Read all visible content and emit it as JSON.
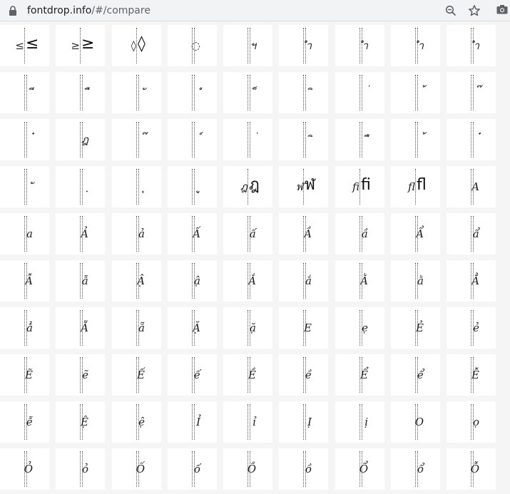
{
  "browser": {
    "url_host": "fontdrop.info",
    "url_path": "/#/compare"
  },
  "icons": {
    "lock": "lock-icon",
    "zoom": "zoom-icon",
    "bookmark": "star-icon",
    "screenshot": "camera-icon"
  },
  "rows": [
    [
      [
        "≤",
        "≤"
      ],
      [
        "≥",
        "≥"
      ],
      [
        "◊",
        "◊"
      ],
      [
        "◌",
        ""
      ],
      [
        "ฯ",
        ""
      ],
      [
        "ำ",
        ""
      ],
      [
        "ำ",
        ""
      ],
      [
        "ำ",
        ""
      ],
      [
        "ำ",
        ""
      ]
    ],
    [
      [
        "ี",
        ""
      ],
      [
        "ื",
        ""
      ],
      [
        "ั",
        ""
      ],
      [
        "ํ",
        ""
      ],
      [
        "็",
        ""
      ],
      [
        "ิ",
        ""
      ],
      [
        "่",
        ""
      ],
      [
        "้",
        ""
      ],
      [
        "๊",
        ""
      ]
    ],
    [
      [
        "๋",
        ""
      ],
      [
        "ฎ",
        ""
      ],
      [
        "๊",
        ""
      ],
      [
        "์",
        ""
      ],
      [
        "่",
        ""
      ],
      [
        "ิ",
        ""
      ],
      [
        "ื",
        ""
      ],
      [
        "้",
        ""
      ],
      [
        "๋",
        ""
      ]
    ],
    [
      [
        "ั",
        ""
      ],
      [
        "ฺ",
        ""
      ],
      [
        "ุ",
        ""
      ],
      [
        "ู",
        ""
      ],
      [
        "ฎ",
        "ฎ"
      ],
      [
        "ฬ",
        "ฬ"
      ],
      [
        "ﬁ",
        "ﬁ"
      ],
      [
        "ﬂ",
        "ﬂ"
      ],
      [
        "A",
        ""
      ]
    ],
    [
      [
        "a",
        ""
      ],
      [
        "Ả",
        ""
      ],
      [
        "ả",
        ""
      ],
      [
        "Ấ",
        ""
      ],
      [
        "ấ",
        ""
      ],
      [
        "Ầ",
        ""
      ],
      [
        "ầ",
        ""
      ],
      [
        "Ẩ",
        ""
      ],
      [
        "ẩ",
        ""
      ]
    ],
    [
      [
        "Ẫ",
        ""
      ],
      [
        "ẫ",
        ""
      ],
      [
        "Ậ",
        ""
      ],
      [
        "ậ",
        ""
      ],
      [
        "Ắ",
        ""
      ],
      [
        "ắ",
        ""
      ],
      [
        "Ằ",
        ""
      ],
      [
        "ằ",
        ""
      ],
      [
        "Ẳ",
        ""
      ]
    ],
    [
      [
        "ẳ",
        ""
      ],
      [
        "Ẵ",
        ""
      ],
      [
        "ẵ",
        ""
      ],
      [
        "Ặ",
        ""
      ],
      [
        "ặ",
        ""
      ],
      [
        "E",
        ""
      ],
      [
        "ẹ",
        ""
      ],
      [
        "Ẻ",
        ""
      ],
      [
        "ẻ",
        ""
      ]
    ],
    [
      [
        "Ẽ",
        ""
      ],
      [
        "ẽ",
        ""
      ],
      [
        "Ế",
        ""
      ],
      [
        "ế",
        ""
      ],
      [
        "Ề",
        ""
      ],
      [
        "ề",
        ""
      ],
      [
        "Ể",
        ""
      ],
      [
        "ể",
        ""
      ],
      [
        "Ễ",
        ""
      ]
    ],
    [
      [
        "ễ",
        ""
      ],
      [
        "Ệ",
        ""
      ],
      [
        "ệ",
        ""
      ],
      [
        "Ỉ",
        ""
      ],
      [
        "ỉ",
        ""
      ],
      [
        "Ị",
        ""
      ],
      [
        "ị",
        ""
      ],
      [
        "O",
        ""
      ],
      [
        "ọ",
        ""
      ]
    ],
    [
      [
        "Ỏ",
        ""
      ],
      [
        "ỏ",
        ""
      ],
      [
        "Ố",
        ""
      ],
      [
        "ố",
        ""
      ],
      [
        "Ồ",
        ""
      ],
      [
        "ồ",
        ""
      ],
      [
        "Ổ",
        ""
      ],
      [
        "ổ",
        ""
      ],
      [
        "Ỗ",
        ""
      ]
    ]
  ]
}
